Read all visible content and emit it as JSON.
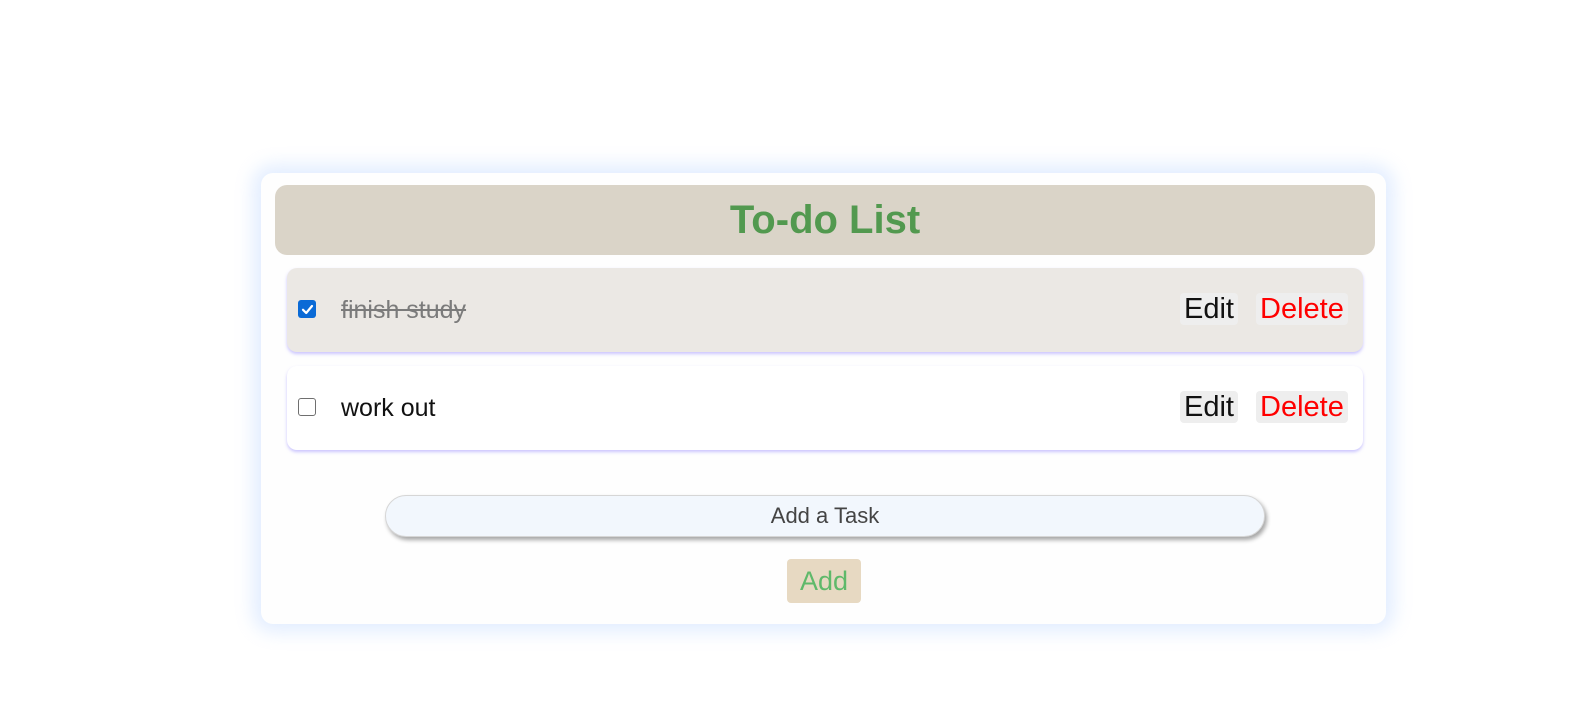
{
  "header": {
    "title": "To-do List"
  },
  "tasks": [
    {
      "text": "finish study",
      "completed": true,
      "edit_label": "Edit",
      "delete_label": "Delete"
    },
    {
      "text": "work out",
      "completed": false,
      "edit_label": "Edit",
      "delete_label": "Delete"
    }
  ],
  "add_form": {
    "placeholder": "Add a Task",
    "button_label": "Add"
  },
  "colors": {
    "title": "#52994f",
    "header_bg": "#dad4c8",
    "delete_text": "#ff0000",
    "add_button_text": "#5fb96a",
    "add_button_bg": "#e7d9c2",
    "checkbox_checked": "#0a6ad6"
  },
  "icons": {
    "checked": "checkmark-icon"
  }
}
